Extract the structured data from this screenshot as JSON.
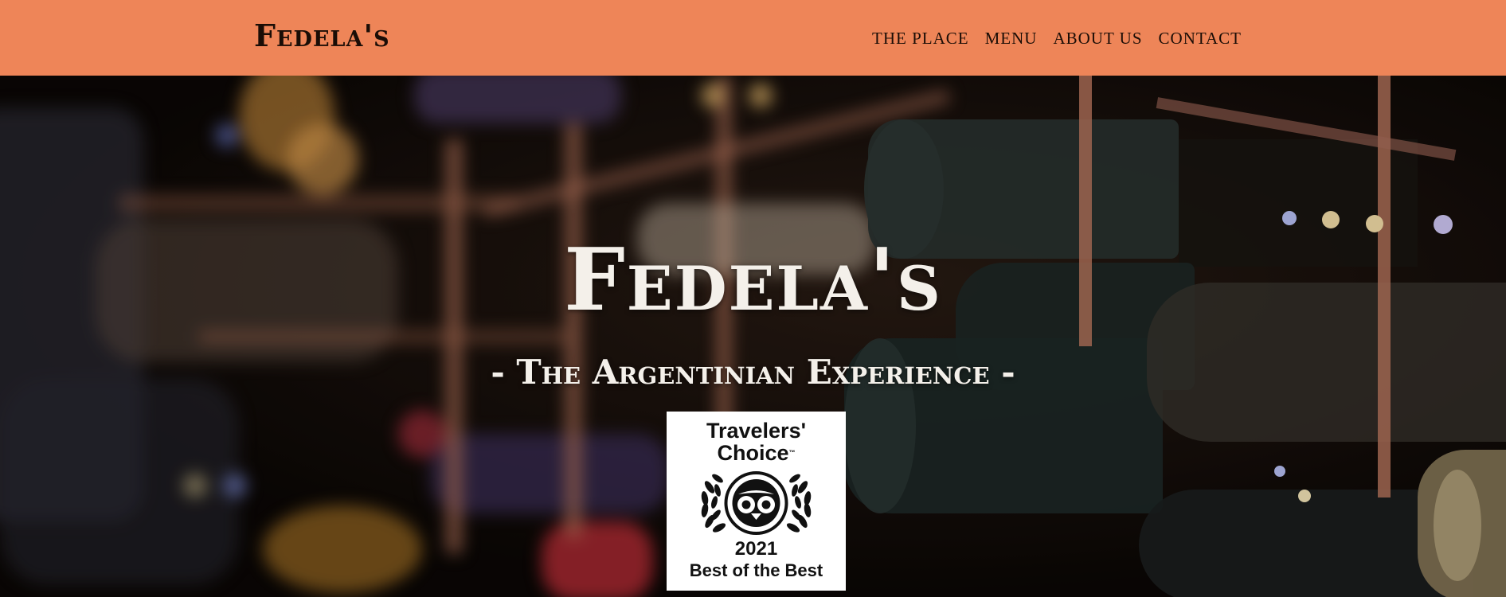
{
  "site": {
    "logo": "Fedela's"
  },
  "nav": {
    "items": [
      "THE PLACE",
      "MENU",
      "ABOUT US",
      "CONTACT"
    ]
  },
  "hero": {
    "title": "Fedela's",
    "subtitle": "- The Argentinian Experience -"
  },
  "badge": {
    "line1": "Travelers'",
    "line2": "Choice",
    "trademark": "™",
    "year": "2021",
    "caption": "Best of the Best"
  },
  "colors": {
    "header_bg": "#ee8558",
    "header_text": "#1a0d06",
    "hero_text": "#f4f0ea",
    "badge_bg": "#ffffff"
  },
  "icons": {
    "badge_emblem": "tripadvisor-owl-laurel-icon"
  }
}
